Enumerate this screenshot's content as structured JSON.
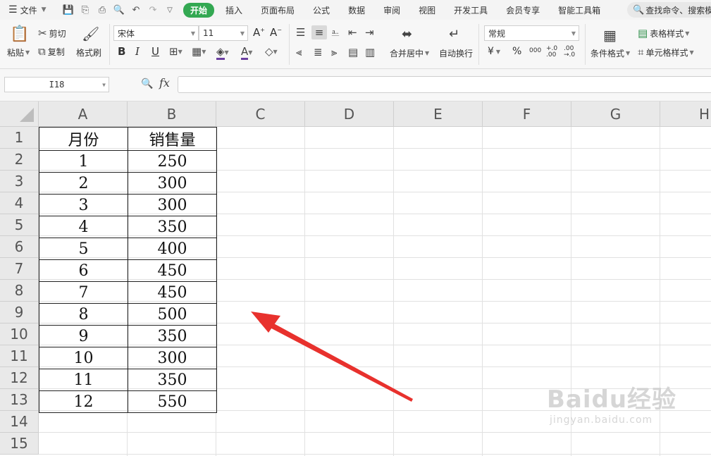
{
  "menu": {
    "file_label": "文件",
    "tabs": [
      "开始",
      "插入",
      "页面布局",
      "公式",
      "数据",
      "审阅",
      "视图",
      "开发工具",
      "会员专享",
      "智能工具箱"
    ],
    "active_tab": "开始",
    "search_placeholder": "查找命令、搜索模"
  },
  "ribbon": {
    "paste_label": "粘贴",
    "cut_label": "剪切",
    "copy_label": "复制",
    "format_painter_label": "格式刷",
    "font_name": "宋体",
    "font_size": "11",
    "merge_label": "合并居中",
    "wrap_label": "自动换行",
    "number_format": "常规",
    "conditional_format_label": "条件格式",
    "table_style_label": "表格样式",
    "cell_style_label": "单元格样式",
    "bold": "B",
    "italic": "I",
    "underline": "U",
    "currency": "¥",
    "percent": "%",
    "thousands": "000",
    "inc_decimal": "+.0 .00",
    "dec_decimal": ".00 →.0"
  },
  "formula_bar": {
    "cell_ref": "I18",
    "fx": "fx",
    "value": ""
  },
  "sheet": {
    "columns": [
      "A",
      "B",
      "C",
      "D",
      "E",
      "F",
      "G",
      "H"
    ],
    "rows": [
      "1",
      "2",
      "3",
      "4",
      "5",
      "6",
      "7",
      "8",
      "9",
      "10",
      "11",
      "12",
      "13",
      "14",
      "15"
    ],
    "header": [
      "月份",
      "销售量"
    ],
    "data": [
      [
        "1",
        "250"
      ],
      [
        "2",
        "300"
      ],
      [
        "3",
        "300"
      ],
      [
        "4",
        "350"
      ],
      [
        "5",
        "400"
      ],
      [
        "6",
        "450"
      ],
      [
        "7",
        "450"
      ],
      [
        "8",
        "500"
      ],
      [
        "9",
        "350"
      ],
      [
        "10",
        "300"
      ],
      [
        "11",
        "350"
      ],
      [
        "12",
        "550"
      ]
    ]
  },
  "annotation": {
    "arrow_color": "#e8312d"
  },
  "watermark": {
    "brand": "Baidu经验",
    "url": "jingyan.baidu.com"
  }
}
